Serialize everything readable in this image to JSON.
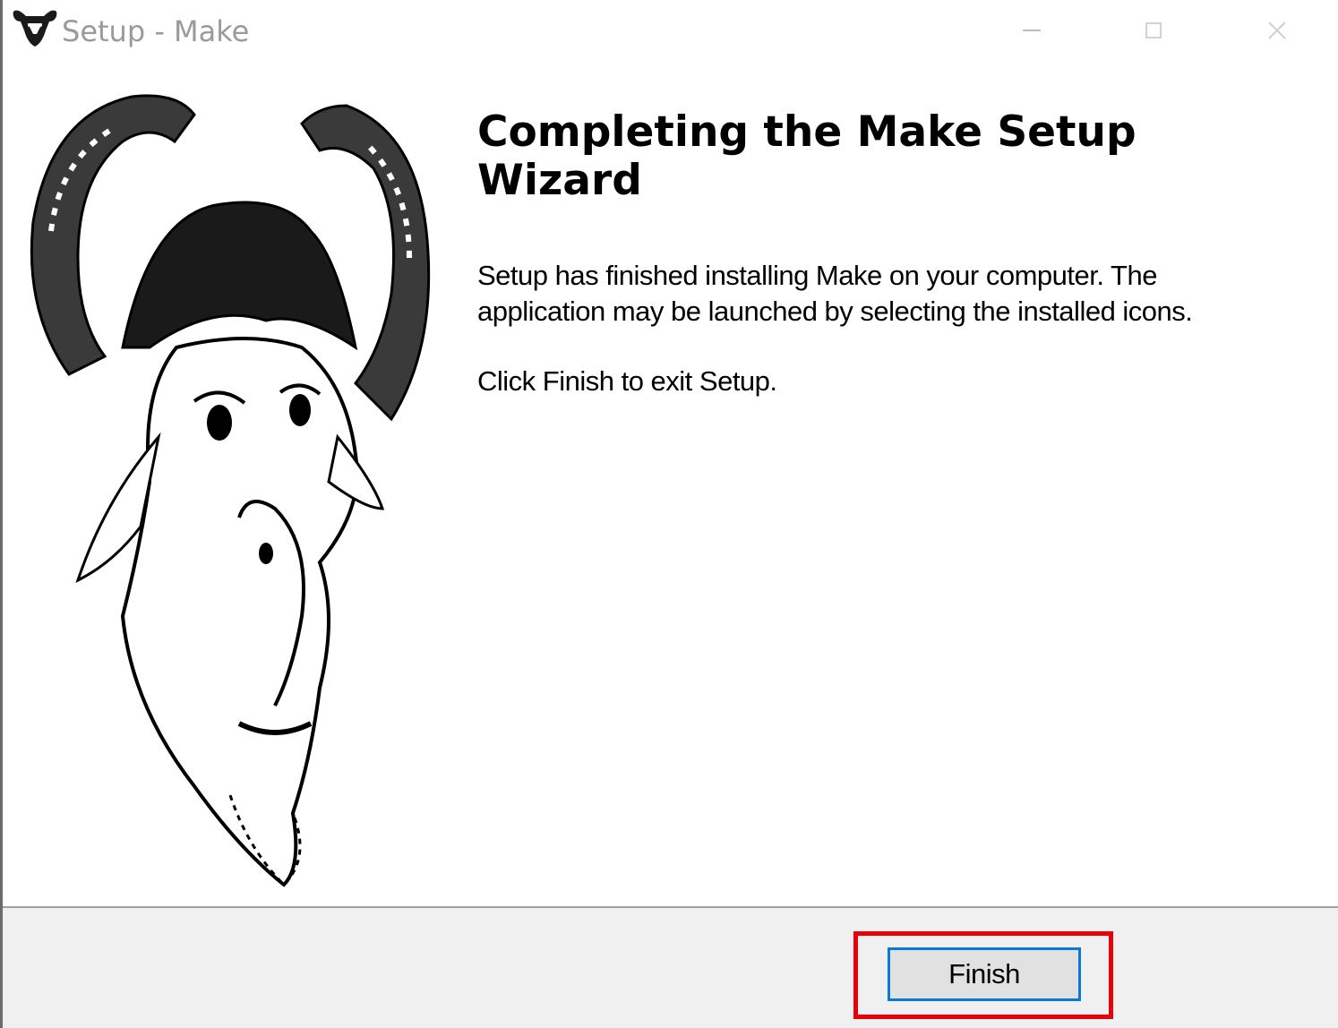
{
  "window": {
    "title": "Setup - Make",
    "icon": "gnu-head-icon",
    "controls": [
      "minimize-icon",
      "maximize-icon",
      "close-icon"
    ]
  },
  "wizard": {
    "heading": "Completing the Make Setup Wizard",
    "message": "Setup has finished installing Make on your computer. The application may be launched by selecting the installed icons.",
    "instruction": "Click Finish to exit Setup.",
    "banner_image": "gnu-head-illustration"
  },
  "footer": {
    "finish_label": "Finish"
  },
  "colors": {
    "highlight": "#e8000b",
    "button_focus": "#0a78d7",
    "footer_bg": "#f0f0f0"
  }
}
